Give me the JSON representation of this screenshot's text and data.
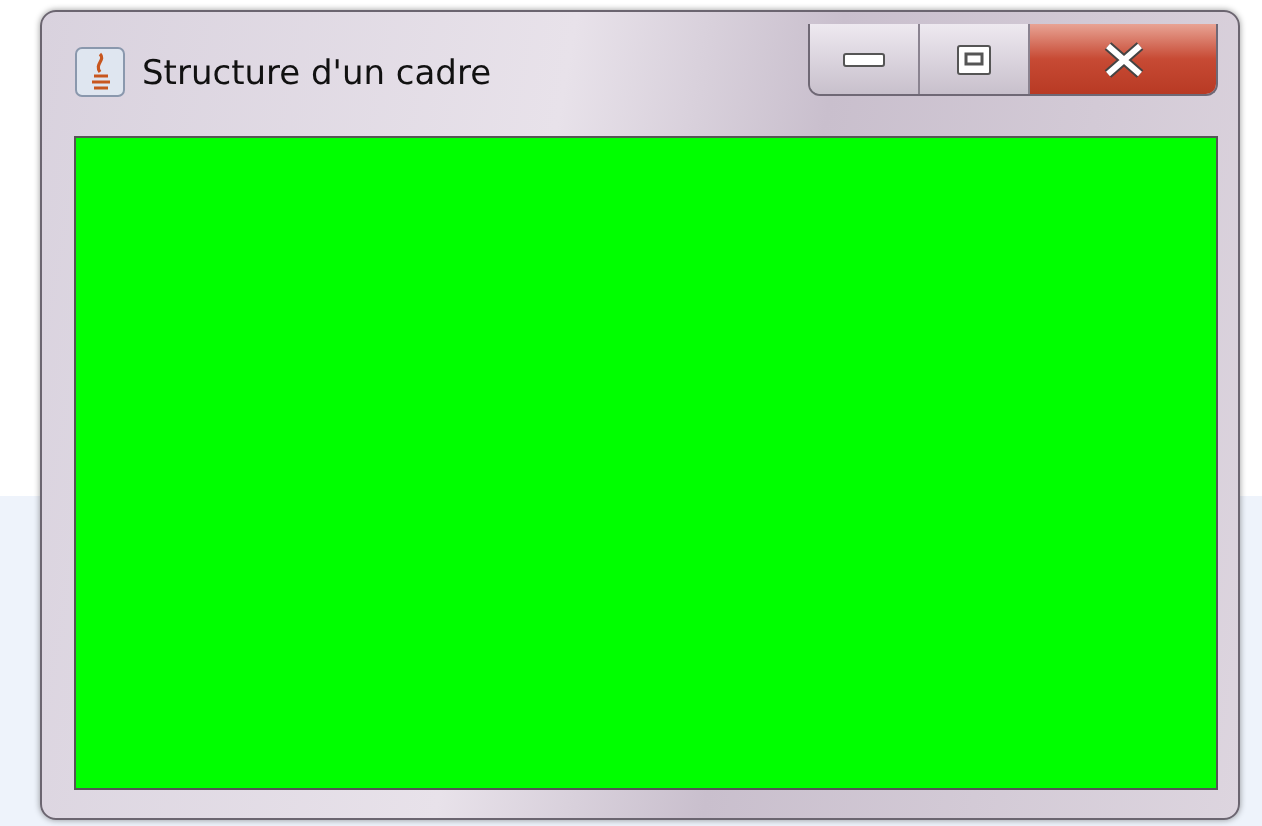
{
  "window": {
    "title": "Structure d'un cadre"
  }
}
